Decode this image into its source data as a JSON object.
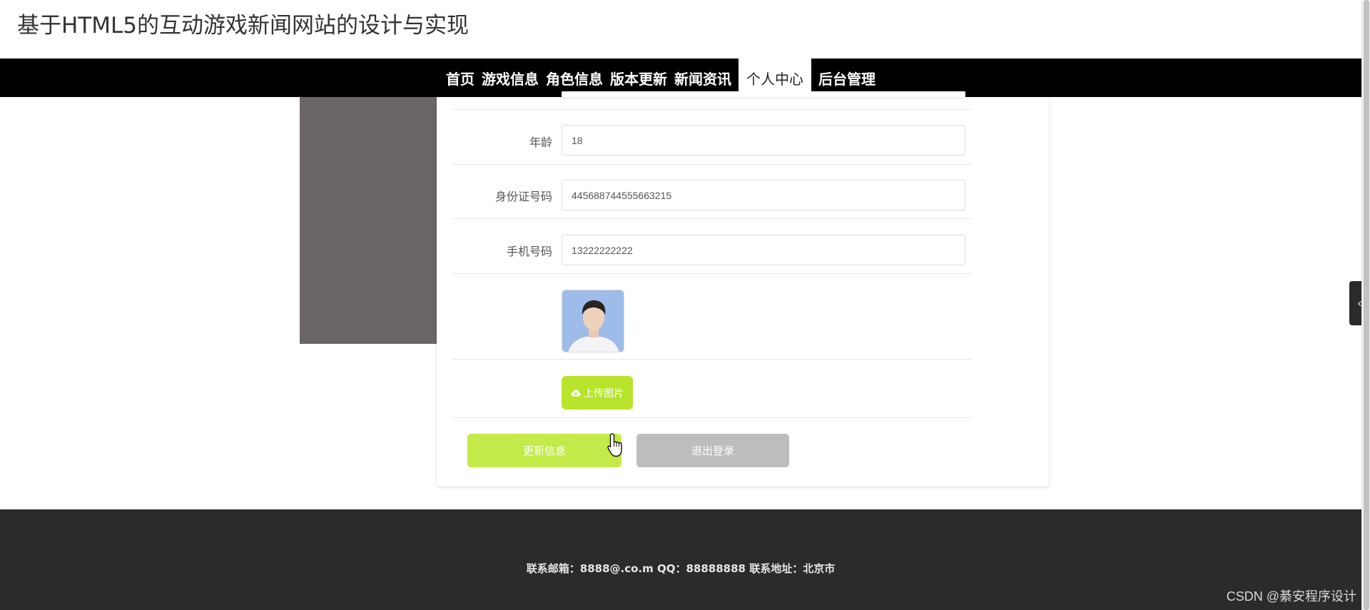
{
  "site": {
    "title": "基于HTML5的互动游戏新闻网站的设计与实现"
  },
  "nav": {
    "items": [
      {
        "label": "首页"
      },
      {
        "label": "游戏信息"
      },
      {
        "label": "角色信息"
      },
      {
        "label": "版本更新"
      },
      {
        "label": "新闻资讯"
      },
      {
        "label": "个人中心",
        "active": true
      },
      {
        "label": "后台管理"
      }
    ]
  },
  "form": {
    "fields": [
      {
        "label": "年龄",
        "value": "18"
      },
      {
        "label": "身份证号码",
        "value": "445688744555663215"
      },
      {
        "label": "手机号码",
        "value": "13222222222"
      }
    ],
    "upload_label": "上传图片",
    "update_label": "更新信息",
    "logout_label": "退出登录"
  },
  "footer": {
    "text": "联系邮箱：8888@.co.m QQ：88888888 联系地址：北京市"
  },
  "watermark": "CSDN @綦安程序设计",
  "colors": {
    "accent": "#c4ea49",
    "nav_bg": "#000000",
    "footer_bg": "#2b2b2b",
    "side_panel": "#6b6566"
  },
  "icons": {
    "upload": "cloud-upload-icon",
    "toggle": "chevron-left-icon",
    "cursor": "hand-pointer-icon"
  }
}
